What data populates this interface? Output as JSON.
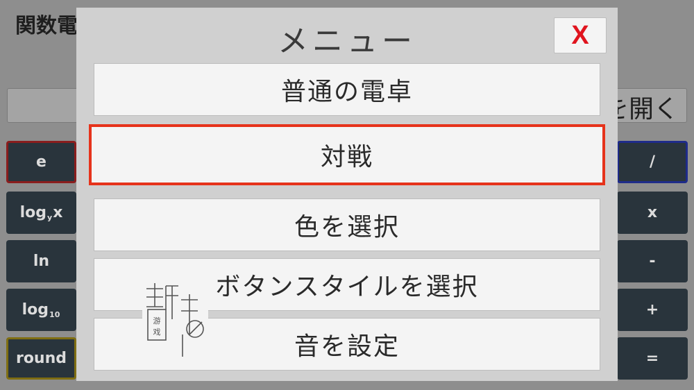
{
  "background": {
    "title": "関数電卓",
    "open_label": "を開く",
    "left_keys": [
      "e",
      "log",
      "ln",
      "log",
      "round"
    ],
    "left_key_subscripts": [
      "",
      "y",
      "",
      "10",
      ""
    ],
    "left_key_suffixes": [
      "",
      "x",
      "",
      "",
      ""
    ],
    "right_keys": [
      "/",
      "x",
      "-",
      "+",
      "="
    ]
  },
  "menu": {
    "title": "メニュー",
    "close_label": "X",
    "items": [
      {
        "label": "普通の電卓"
      },
      {
        "label": "対戦"
      },
      {
        "label": "色を選択"
      },
      {
        "label": "ボタンスタイルを選択"
      },
      {
        "label": "音を設定"
      }
    ]
  },
  "colors": {
    "selected_border": "#e6331b",
    "close_x": "#e0141e",
    "modal_bg": "#d0d0d0"
  },
  "watermark": {
    "text": "游戏"
  }
}
